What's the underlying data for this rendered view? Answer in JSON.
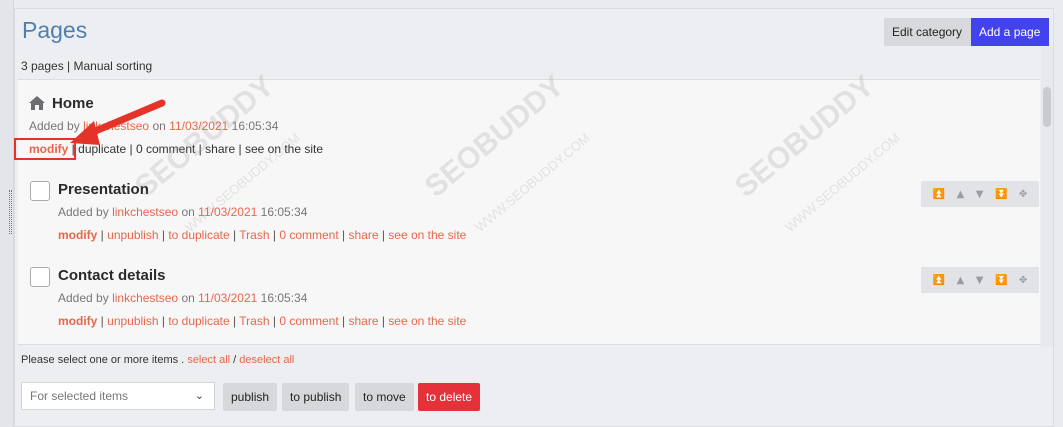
{
  "header": {
    "title": "Pages",
    "edit_category": "Edit category",
    "add_page": "Add a page"
  },
  "summary": "3 pages | Manual sorting",
  "items": [
    {
      "title": "Home",
      "added_by_prefix": "Added by",
      "author": "linkchestseo",
      "on": "on",
      "date": "11/03/2021",
      "time": "16:05:34",
      "actions": {
        "modify": "modify",
        "duplicate": "duplicate",
        "comment": "0 comment",
        "share": "share",
        "see": "see on the site"
      }
    },
    {
      "title": "Presentation",
      "added_by_prefix": "Added by",
      "author": "linkchestseo",
      "on": "on",
      "date": "11/03/2021",
      "time": "16:05:34",
      "actions": {
        "modify": "modify",
        "unpublish": "unpublish",
        "duplicate": "to duplicate",
        "trash": "Trash",
        "comment": "0 comment",
        "share": "share",
        "see": "see on the site"
      }
    },
    {
      "title": "Contact details",
      "added_by_prefix": "Added by",
      "author": "linkchestseo",
      "on": "on",
      "date": "11/03/2021",
      "time": "16:05:34",
      "actions": {
        "modify": "modify",
        "unpublish": "unpublish",
        "duplicate": "to duplicate",
        "trash": "Trash",
        "comment": "0 comment",
        "share": "share",
        "see": "see on the site"
      }
    }
  ],
  "bottom": {
    "note": "Please select one or more items .",
    "select_all": "select all",
    "slash": "/",
    "deselect_all": "deselect all",
    "select_placeholder": "For selected items",
    "publish": "publish",
    "to_publish": "to publish",
    "to_move": "to move",
    "to_delete": "to delete"
  },
  "watermark": {
    "big": "SEOBUDDY",
    "small": "WWW.SEOBUDDY.COM"
  },
  "icons": [
    "home-icon",
    "move-top-icon",
    "move-up-icon",
    "move-down-icon",
    "move-bottom-icon",
    "drag-icon",
    "chevron-down-icon"
  ],
  "colors": {
    "title": "#4f7fae",
    "link": "#e8664a",
    "add_button": "#4343ee",
    "delete_button": "#e5313a",
    "annotation": "#e5332a"
  }
}
